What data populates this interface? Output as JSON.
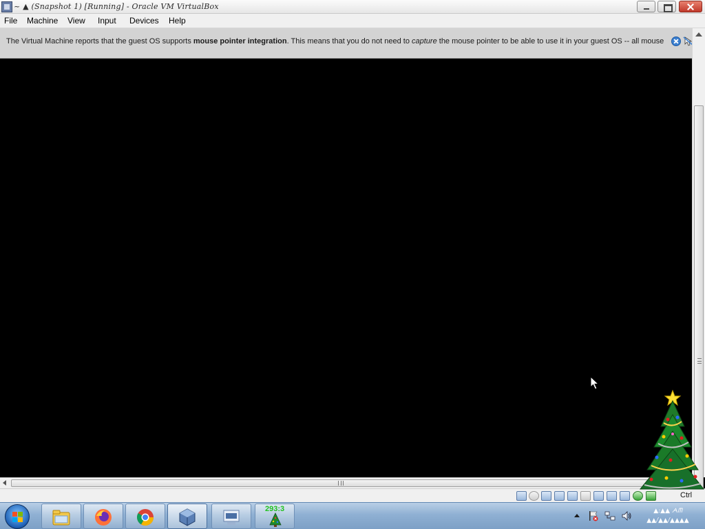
{
  "window": {
    "title": "~ ▲ (Snapshot 1) [Running] - Oracle VM VirtualBox"
  },
  "menu": {
    "file": "File",
    "machine": "Machine",
    "view": "View",
    "input": "Input",
    "devices": "Devices",
    "help": "Help"
  },
  "notice": {
    "part1": "The Virtual Machine reports that the guest OS supports ",
    "bold": "mouse pointer integration",
    "part2": ". This means that you do not need to ",
    "italic": "capture",
    "part3": " the mouse pointer to be able to use it in your guest OS -- all mouse"
  },
  "statusbar": {
    "host_key": "Ctrl",
    "icons": [
      "hard-disk-icon",
      "optical-drive-icon",
      "audio-icon",
      "network-icon",
      "usb-icon",
      "shared-folders-icon",
      "display-icon",
      "video-capture-icon",
      "virtualization-icon",
      "mouse-integration-icon"
    ]
  },
  "taskbar": {
    "counter": "293:3",
    "apps": [
      "file-explorer-icon",
      "firefox-icon",
      "chrome-icon",
      "virtualbox-icon",
      "keyboard-window-icon",
      "christmas-tree-icon"
    ]
  },
  "tray": {
    "clock_time": "▲:▲▲ ᗅᗰ",
    "clock_date": "▲▲/▲▲/▲▲▲▲"
  },
  "colors": {
    "accent": "#3b7fd0",
    "notice_bg": "#d3d3d3",
    "counter_green": "#1fc11f",
    "taskbar": "#8fb0d3"
  }
}
